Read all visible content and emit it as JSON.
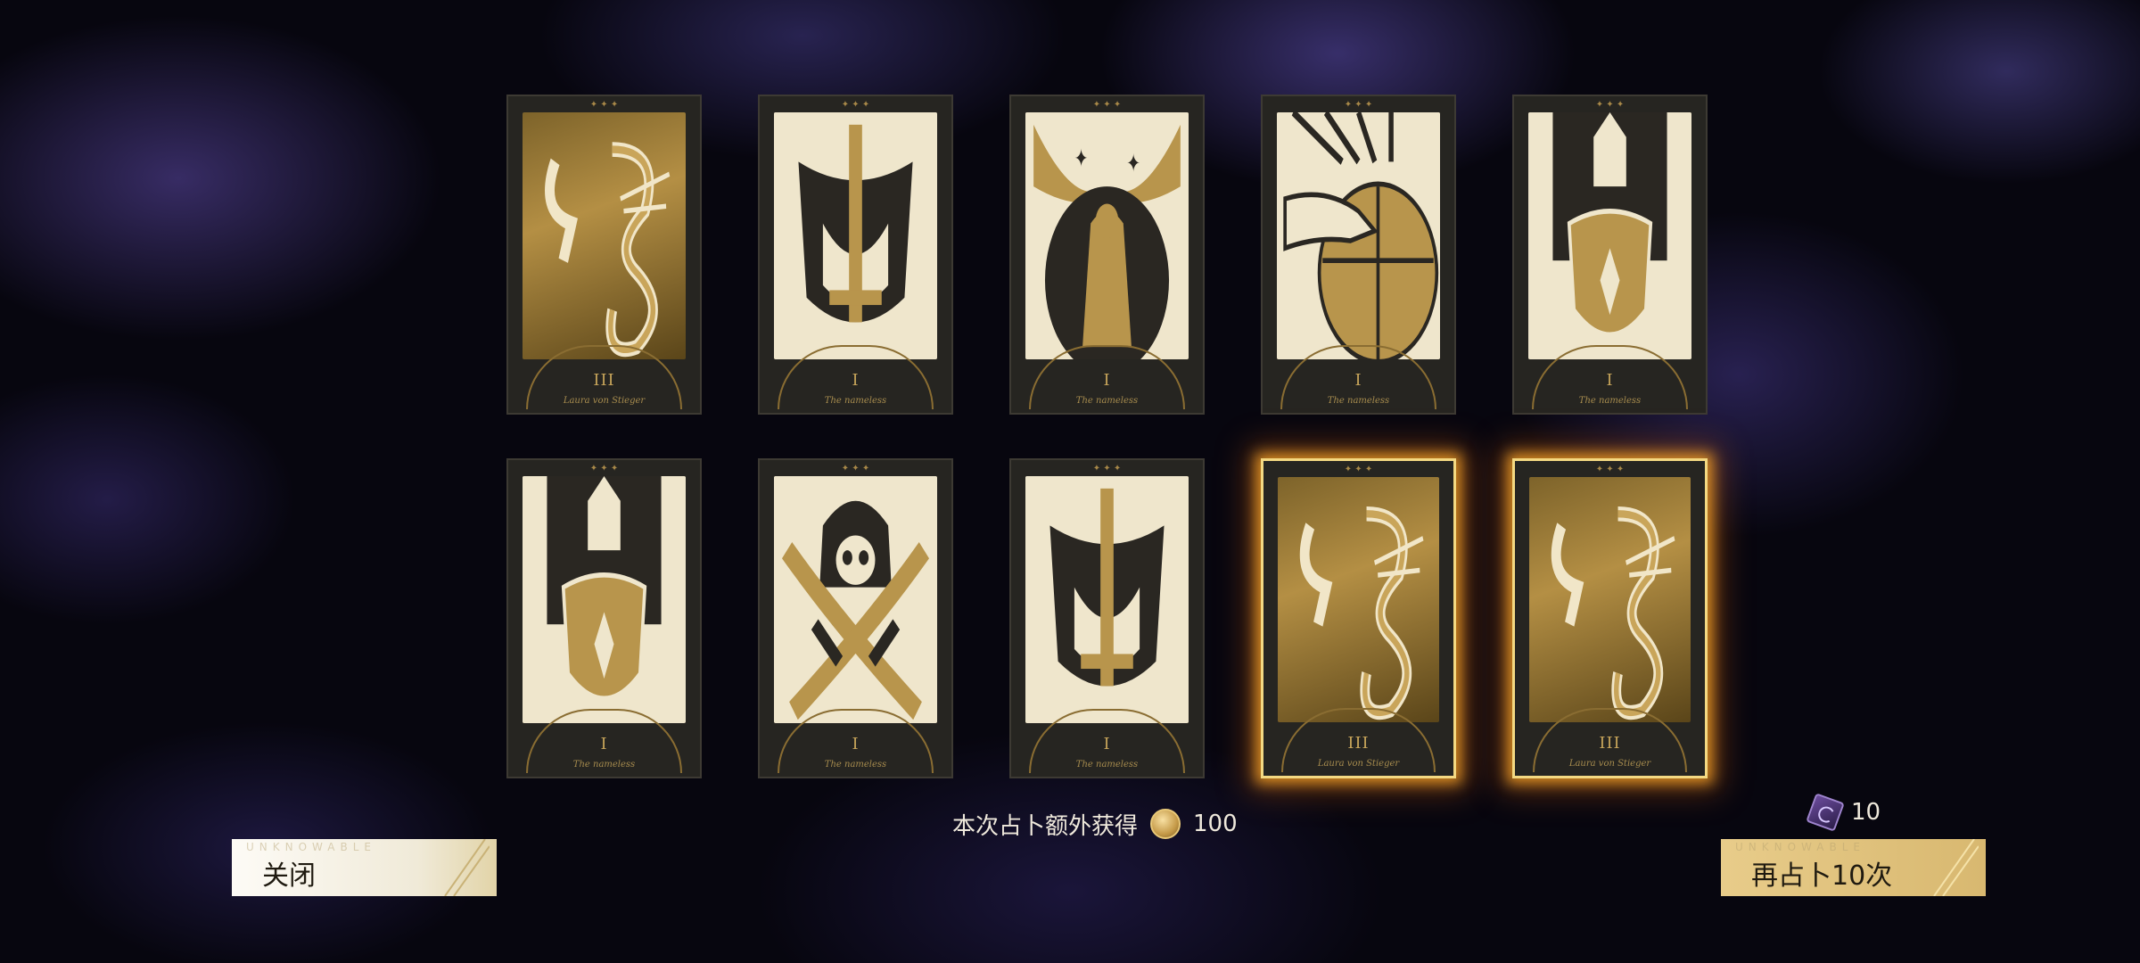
{
  "cards": [
    {
      "numeral": "III",
      "name": "Laura von Stieger",
      "glow": true,
      "art": "serpent-dragon-icon"
    },
    {
      "numeral": "I",
      "name": "The nameless",
      "glow": false,
      "art": "sword-knight-icon"
    },
    {
      "numeral": "I",
      "name": "The nameless",
      "glow": false,
      "art": "moon-maiden-icon"
    },
    {
      "numeral": "I",
      "name": "The nameless",
      "glow": false,
      "art": "hand-globe-icon"
    },
    {
      "numeral": "I",
      "name": "The nameless",
      "glow": false,
      "art": "shield-knight-icon"
    },
    {
      "numeral": "I",
      "name": "The nameless",
      "glow": false,
      "art": "shield-knight-icon"
    },
    {
      "numeral": "I",
      "name": "The nameless",
      "glow": false,
      "art": "hooded-skull-icon"
    },
    {
      "numeral": "I",
      "name": "The nameless",
      "glow": false,
      "art": "sword-knight-icon"
    },
    {
      "numeral": "III",
      "name": "Laura von Stieger",
      "glow": true,
      "art": "serpent-dragon-icon"
    },
    {
      "numeral": "III",
      "name": "Laura von Stieger",
      "glow": true,
      "art": "serpent-dragon-icon"
    }
  ],
  "bonus": {
    "text": "本次占卜额外获得",
    "amount": "100",
    "icon": "coin-icon"
  },
  "ticket": {
    "count": "10",
    "icon": "divination-ticket-icon"
  },
  "buttons": {
    "close": {
      "sub": "UNKNOWABLE",
      "label": "关闭"
    },
    "again": {
      "sub": "UNKNOWABLE",
      "label": "再占卜10次"
    }
  },
  "colors": {
    "glow": "#f4d982",
    "gold": "#c7a45a",
    "background": "#07060f",
    "accent": "#6b4b9c"
  }
}
